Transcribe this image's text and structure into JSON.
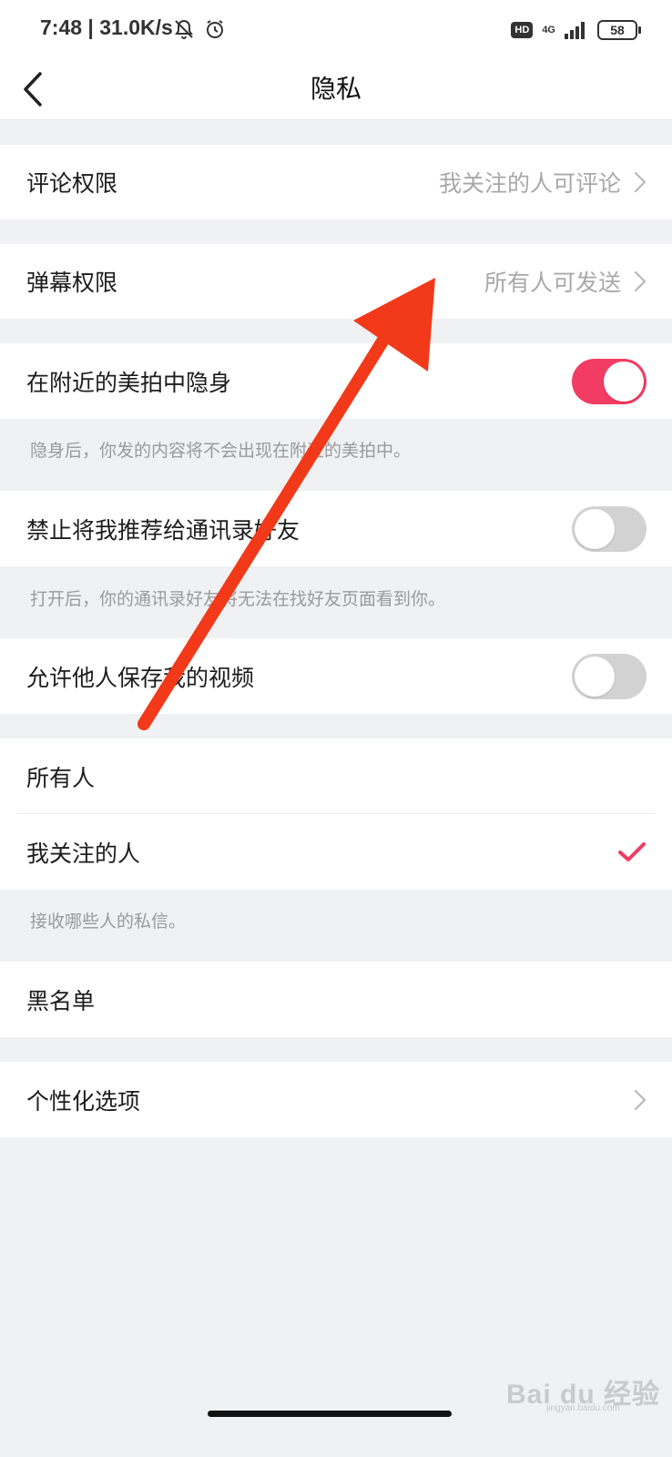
{
  "status_bar": {
    "time": "7:48 | 31.0K/s",
    "network": "4G",
    "battery": "58",
    "hd_badge": "HD"
  },
  "header": {
    "title": "隐私",
    "back_icon": "chevron-left-icon"
  },
  "settings": {
    "comment_permission": {
      "label": "评论权限",
      "value": "我关注的人可评论"
    },
    "danmaku_permission": {
      "label": "弹幕权限",
      "value": "所有人可发送"
    },
    "hide_nearby": {
      "label": "在附近的美拍中隐身",
      "enabled": true,
      "hint": "隐身后，你发的内容将不会出现在附近的美拍中。"
    },
    "block_contact_recommend": {
      "label": "禁止将我推荐给通讯录好友",
      "enabled": false,
      "hint": "打开后，你的通讯录好友将无法在找好友页面看到你。"
    },
    "allow_save_video": {
      "label": "允许他人保存我的视频",
      "enabled": false
    },
    "message_options": [
      {
        "label": "所有人",
        "selected": false
      },
      {
        "label": "我关注的人",
        "selected": true
      }
    ],
    "message_hint": "接收哪些人的私信。",
    "blacklist": {
      "label": "黑名单"
    },
    "personalization": {
      "label": "个性化选项"
    }
  },
  "watermark": {
    "brand": "Bai du 经验",
    "url": "jingyan.baidu.com"
  },
  "colors": {
    "accent": "#f23c63",
    "toggle_off": "#d2d2d2",
    "annotation_arrow": "#f23a1a",
    "background": "#f0f1f3"
  }
}
